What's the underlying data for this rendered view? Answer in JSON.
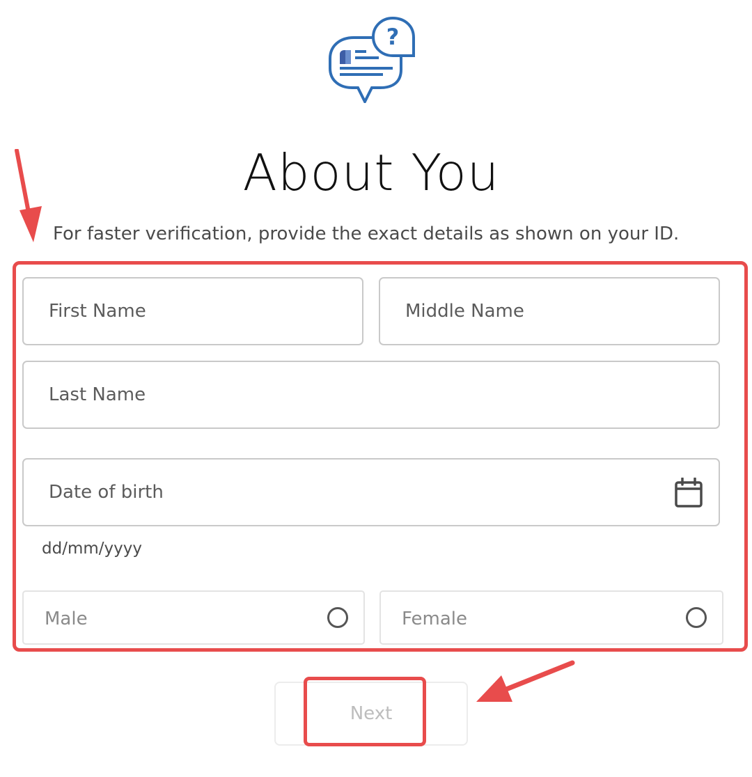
{
  "header": {
    "logo_icon": "id-question-chat-icon",
    "title": "About You",
    "subtitle": "For faster verification, provide the exact details as shown on your ID."
  },
  "form": {
    "first_name": {
      "placeholder": "First Name",
      "value": ""
    },
    "middle_name": {
      "placeholder": "Middle Name",
      "value": ""
    },
    "last_name": {
      "placeholder": "Last Name",
      "value": ""
    },
    "date_of_birth": {
      "placeholder": "Date of birth",
      "value": "",
      "hint": "dd/mm/yyyy",
      "icon": "calendar-icon"
    },
    "gender_options": [
      {
        "label": "Male",
        "selected": false
      },
      {
        "label": "Female",
        "selected": false
      }
    ]
  },
  "actions": {
    "next_label": "Next"
  },
  "annotations": {
    "color": "#e84c4c"
  }
}
